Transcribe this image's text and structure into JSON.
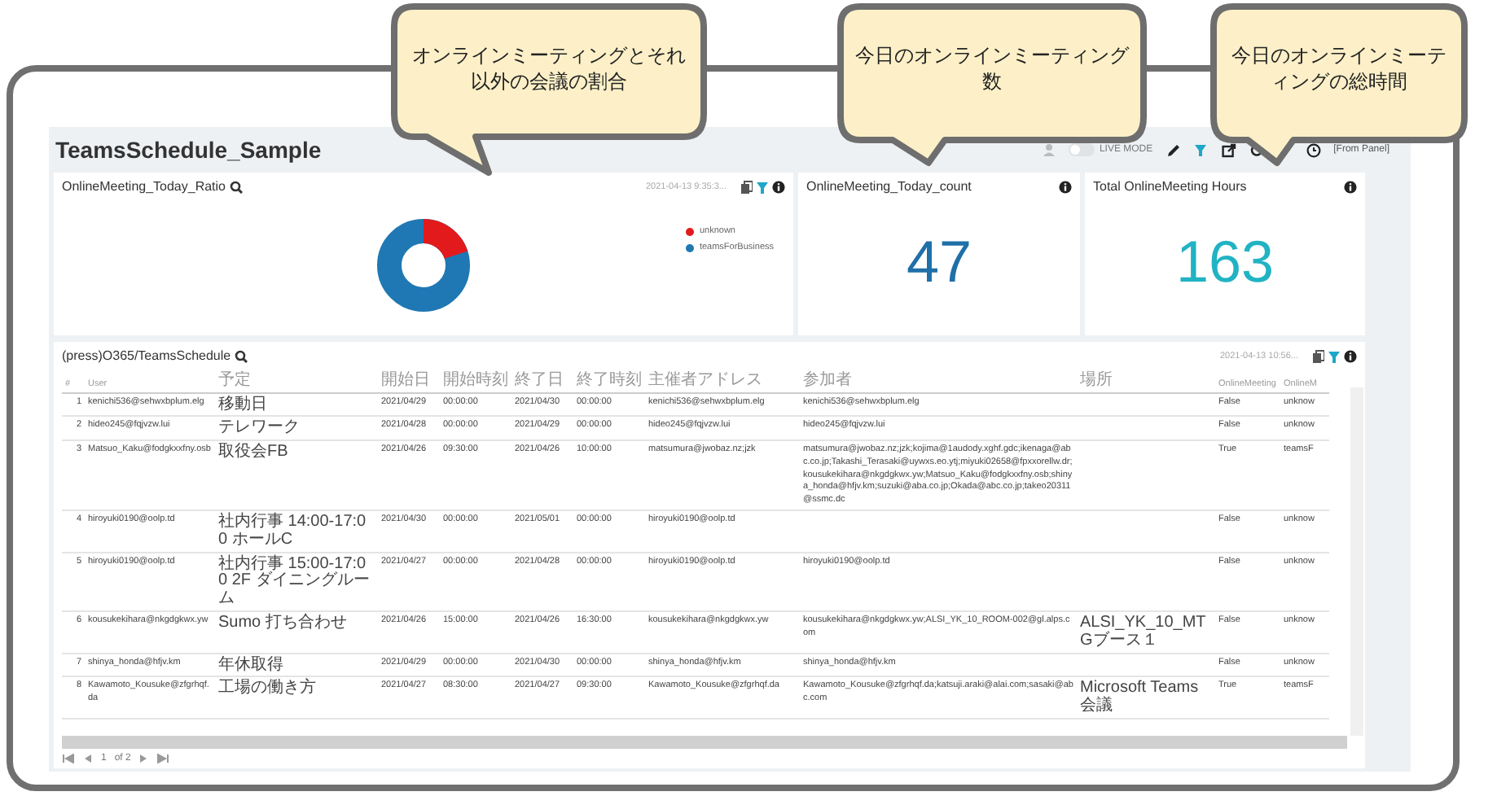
{
  "callouts": [
    {
      "text": "オンラインミーティングとそれ以外の会議の割合"
    },
    {
      "text": "今日のオンラインミーティング数"
    },
    {
      "text": "今日のオンラインミーティングの総時間"
    }
  ],
  "dashboard": {
    "title": "TeamsSchedule_Sample",
    "live_mode": {
      "label": "LIVE MODE",
      "on": false
    },
    "source": "[From Panel]"
  },
  "panels": [
    {
      "kind": "donut",
      "title": "OnlineMeeting_Today_Ratio",
      "timestamp": "2021-04-13 9:35:3...",
      "legend": [
        {
          "label": "unknown",
          "color": "#e31a1c"
        },
        {
          "label": "teamsForBusiness",
          "color": "#1f78b4"
        }
      ]
    },
    {
      "kind": "metric",
      "title": "OnlineMeeting_Today_count",
      "value": "47",
      "color": "#1f6fa8"
    },
    {
      "kind": "metric",
      "title": "Total OnlineMeeting Hours",
      "value": "163",
      "color": "#21b3c3"
    }
  ],
  "table": {
    "title": "(press)O365/TeamsSchedule",
    "timestamp": "2021-04-13 10:56...",
    "columns": [
      "#",
      "User",
      "予定",
      "開始日",
      "開始時刻",
      "終了日",
      "終了時刻",
      "主催者アドレス",
      "参加者",
      "場所",
      "OnlineMeeting",
      "OnlineM"
    ],
    "rows": [
      [
        "1",
        "kenichi536@sehwxbplum.elg",
        "移動日",
        "2021/04/29",
        "00:00:00",
        "2021/04/30",
        "00:00:00",
        "kenichi536@sehwxbplum.elg",
        "kenichi536@sehwxbplum.elg",
        "",
        "False",
        "unknow"
      ],
      [
        "2",
        "hideo245@fqjvzw.lui",
        "テレワーク",
        "2021/04/28",
        "00:00:00",
        "2021/04/29",
        "00:00:00",
        "hideo245@fqjvzw.lui",
        "hideo245@fqjvzw.lui",
        "",
        "False",
        "unknow"
      ],
      [
        "3",
        "Matsuo_Kaku@fodgkxxfny.osb",
        "取役会FB",
        "2021/04/26",
        "09:30:00",
        "2021/04/26",
        "10:00:00",
        "matsumura@jwobaz.nz;jzk",
        "matsumura@jwobaz.nz;jzk;kojima@1audody.xghf.gdc;ikenaga@abc.co.jp;Takashi_Terasaki@uywxs.eo.ytj;miyuki02658@fpxxorellw.dr;kousukekihara@nkgdgkwx.yw;Matsuo_Kaku@fodgkxxfny.osb;shinya_honda@hfjv.km;suzuki@aba.co.jp;Okada@abc.co.jp;takeo20311@ssmc.dc",
        "",
        "True",
        "teamsF"
      ],
      [
        "4",
        "hiroyuki0190@oolp.td",
        "社内行事 14:00-17:00 ホールC",
        "2021/04/30",
        "00:00:00",
        "2021/05/01",
        "00:00:00",
        "hiroyuki0190@oolp.td",
        "",
        "",
        "False",
        "unknow"
      ],
      [
        "5",
        "hiroyuki0190@oolp.td",
        "社内行事 15:00-17:00 2F ダイニングルーム",
        "2021/04/27",
        "00:00:00",
        "2021/04/28",
        "00:00:00",
        "hiroyuki0190@oolp.td",
        "hiroyuki0190@oolp.td",
        "",
        "False",
        "unknow"
      ],
      [
        "6",
        "kousukekihara@nkgdgkwx.yw",
        "Sumo 打ち合わせ",
        "2021/04/26",
        "15:00:00",
        "2021/04/26",
        "16:30:00",
        "kousukekihara@nkgdgkwx.yw",
        "kousukekihara@nkgdgkwx.yw;ALSI_YK_10_ROOM-002@gl.alps.com",
        "ALSI_YK_10_MTGブース１",
        "False",
        "unknow"
      ],
      [
        "7",
        "shinya_honda@hfjv.km",
        "年休取得",
        "2021/04/29",
        "00:00:00",
        "2021/04/30",
        "00:00:00",
        "shinya_honda@hfjv.km",
        "shinya_honda@hfjv.km",
        "",
        "False",
        "unknow"
      ],
      [
        "8",
        "Kawamoto_Kousuke@zfgrhqf.da",
        "工場の働き方",
        "2021/04/27",
        "08:30:00",
        "2021/04/27",
        "09:30:00",
        "Kawamoto_Kousuke@zfgrhqf.da",
        "Kawamoto_Kousuke@zfgrhqf.da;katsuji.araki@alai.com;sasaki@abc.com",
        "Microsoft Teams 会議",
        "True",
        "teamsF"
      ]
    ]
  },
  "pagination": {
    "page": "1",
    "total": "of 2"
  }
}
